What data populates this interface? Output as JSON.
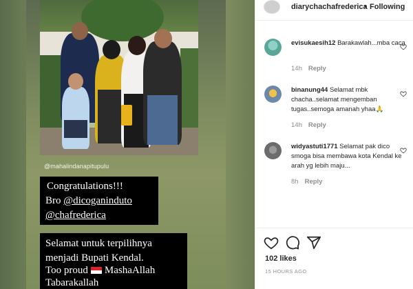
{
  "post": {
    "photo_credit": "@mahalindanapitupulu",
    "story_lines": {
      "l1": "Congratulations!!!",
      "l2_prefix": "Bro ",
      "l2_mention": "@dicoganinduto",
      "l3_mention": "@chafrederica",
      "l4": "Selamat untuk terpilihnya",
      "l5": "menjadi Bupati Kendal.",
      "l6_prefix": "Too proud",
      "l6_suffix": "MashaAllah",
      "l7": "Tabarakallah"
    }
  },
  "header": {
    "username": "diarychachafrederica",
    "separator": "•",
    "follow_status": "Following"
  },
  "comments": [
    {
      "username": "evisukaesih12",
      "text": "Barakawlah...mba caca",
      "time": "14h",
      "reply": "Reply"
    },
    {
      "username": "binanung44",
      "text": "Selamat mbk chacha..selamat mengemban tugas..semoga amanah yhaa🙏",
      "time": "14h",
      "reply": "Reply"
    },
    {
      "username": "widyastuti1771",
      "text": "Selamat pak dico smoga bisa membawa kota Kendal ke arah yg lebih maju...",
      "time": "8h",
      "reply": "Reply"
    }
  ],
  "footer": {
    "likes": "102 likes",
    "time_ago": "15 HOURS AGO"
  },
  "colors": {
    "text_primary": "#262626",
    "text_secondary": "#8e8e8e",
    "divider": "#efefef"
  },
  "icons": [
    "heart-icon",
    "comment-icon",
    "share-icon"
  ]
}
